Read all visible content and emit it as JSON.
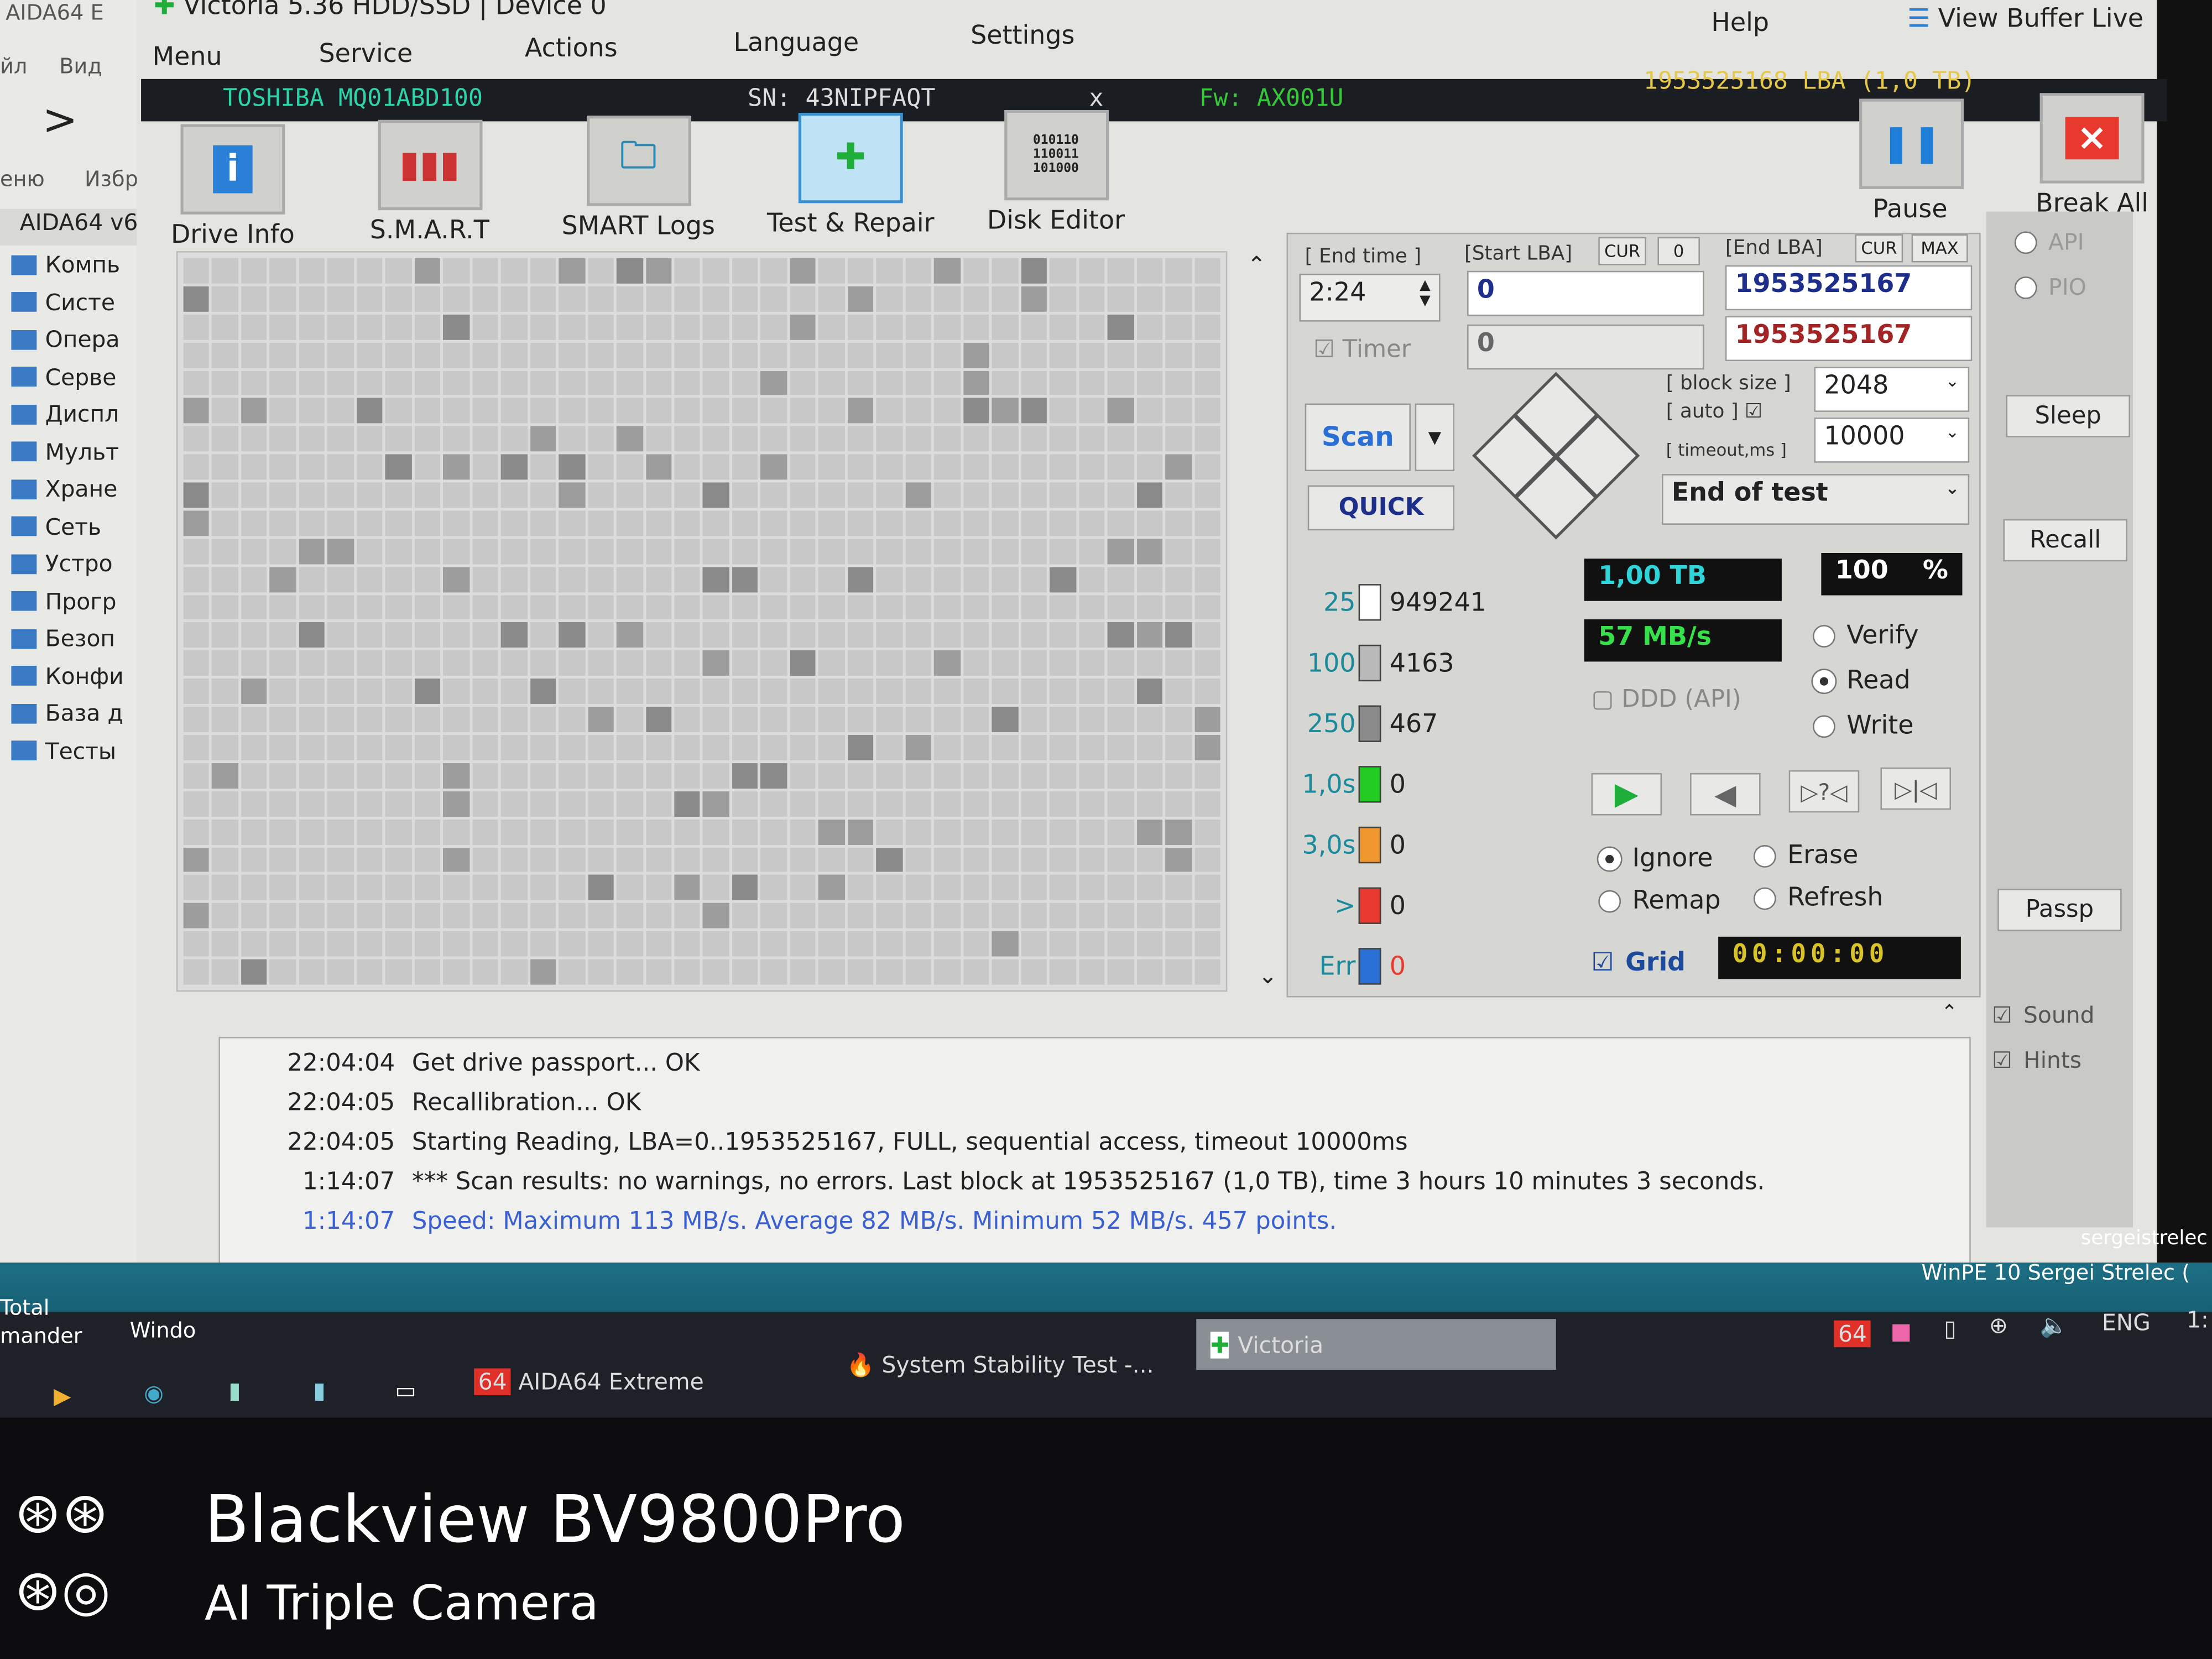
{
  "aida": {
    "title": "AIDA64 E",
    "menu": [
      "йл",
      "Вид"
    ],
    "tabs": [
      "еню",
      "Избр"
    ],
    "root": "AIDA64 v6",
    "tree": [
      "Компь",
      "Систе",
      "Опера",
      "Серве",
      "Диспл",
      "Мульт",
      "Хране",
      "Сеть",
      "Устро",
      "Прогр",
      "Безоп",
      "Конфи",
      "База д",
      "Тесты"
    ]
  },
  "window": {
    "title": "Victoria 5.36 HDD/SSD | Device 0"
  },
  "menu": {
    "items": [
      "Menu",
      "Service",
      "Actions",
      "Language",
      "Settings",
      "Help"
    ],
    "view_buffer": "View Buffer Live"
  },
  "drive": {
    "model": "TOSHIBA MQ01ABD100",
    "serial": "SN: 43NIPFAQT",
    "close": "x",
    "firmware": "Fw: AX001U",
    "capacity": "1953525168 LBA (1,0 TB)"
  },
  "toolbar": {
    "drive_info": "Drive Info",
    "smart": "S.M.A.R.T",
    "smart_logs": "SMART Logs",
    "test_repair": "Test & Repair",
    "disk_editor": "Disk Editor",
    "pause": "Pause",
    "break_all": "Break All"
  },
  "test": {
    "end_time_label": "[ End time ]",
    "end_time": "2:24",
    "timer_label": "Timer",
    "start_lba_label": "[Start LBA]",
    "cur": "CUR",
    "zero_btn": "0",
    "start_lba": "0",
    "current_lba": "0",
    "end_lba_label": "[End LBA]",
    "max": "MAX",
    "end_lba": "1953525167",
    "end_lba_current": "1953525167",
    "block_size_label": "[ block size ]",
    "auto_label": "[ auto ]",
    "block_size": "2048",
    "timeout_label": "[ timeout,ms ]",
    "timeout": "10000",
    "scan": "Scan",
    "quick": "QUICK",
    "end_action": "End of test",
    "size": "1,00 TB",
    "percent": "100",
    "percent_unit": "%",
    "speed": "57 MB/s",
    "ddd": "DDD (API)",
    "mode": {
      "verify": "Verify",
      "read": "Read",
      "write": "Write",
      "selected": "Read"
    },
    "action": {
      "ignore": "Ignore",
      "erase": "Erase",
      "remap": "Remap",
      "refresh": "Refresh",
      "selected": "Ignore"
    },
    "grid_label": "Grid",
    "clock": "00:00:00",
    "legend": [
      {
        "label": "25",
        "count": "949241",
        "color": "#ffffff"
      },
      {
        "label": "100",
        "count": "4163",
        "color": "#b9b9b9"
      },
      {
        "label": "250",
        "count": "467",
        "color": "#8a8a8a"
      },
      {
        "label": "1,0s",
        "count": "0",
        "color": "#22cc22"
      },
      {
        "label": "3,0s",
        "count": "0",
        "color": "#f0962e"
      },
      {
        "label": ">",
        "count": "0",
        "color": "#e8392e"
      },
      {
        "label": "Err",
        "count": "0",
        "color": "#2a6fd6"
      }
    ]
  },
  "side": {
    "api": "API",
    "pio": "PIO",
    "sleep": "Sleep",
    "recall": "Recall",
    "passp": "Passp",
    "sound": "Sound",
    "hints": "Hints"
  },
  "log": [
    {
      "time": "22:04:04",
      "text": "Get drive passport... OK"
    },
    {
      "time": "22:04:05",
      "text": "Recallibration... OK"
    },
    {
      "time": "22:04:05",
      "text": "Starting Reading, LBA=0..1953525167, FULL, sequential access, timeout 10000ms"
    },
    {
      "time": "1:14:07",
      "text": "*** Scan results: no warnings, no errors. Last block at 1953525167 (1,0 TB), time 3 hours 10 minutes 3 seconds."
    },
    {
      "time": "1:14:07",
      "text": "Speed: Maximum 113 MB/s. Average 82 MB/s. Minimum 52 MB/s. 457 points.",
      "color": "#3a5fd0"
    }
  ],
  "desktop": {
    "brand1": "sergeistrelec",
    "brand2": "WinPE 10 Sergei Strelec (",
    "left_labels": [
      "Total",
      "mander",
      "Windo"
    ]
  },
  "taskbar": {
    "aida": "AIDA64 Extreme",
    "stability": "System Stability Test -...",
    "victoria": "Victoria",
    "lang": "ENG",
    "time": "1:"
  },
  "watermark": {
    "line1": "Blackview BV9800Pro",
    "line2": "AI  Triple  Camera"
  },
  "colors": {
    "accent_green": "#1fae3a",
    "lcd_cyan": "#2fd3d8",
    "lcd_green": "#35e04a",
    "end_lba_red": "#a32424",
    "end_lba_blue": "#1d2f8a"
  }
}
